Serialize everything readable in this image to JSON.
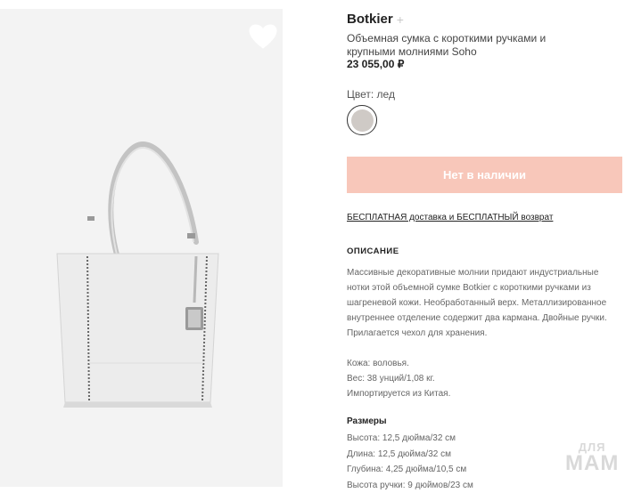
{
  "product": {
    "brand": "Botkier",
    "brand_plus": "+",
    "title": "Объемная сумка с короткими ручками и крупными молниями Soho",
    "price": "23 055,00 ₽"
  },
  "color": {
    "label": "Цвет: лед",
    "swatch_color": "#cfcac6"
  },
  "cta": {
    "label": "Нет в наличии",
    "color": "#f8c7ba"
  },
  "shipping": {
    "link": "БЕСПЛАТНАЯ доставка и БЕСПЛАТНЫЙ возврат"
  },
  "description": {
    "title": "ОПИСАНИЕ",
    "text": "Массивные декоративные молнии придают индустриальные нотки этой объемной сумке Botkier с короткими ручками из шагреневой кожи. Необработанный верх. Металлизированное внутреннее отделение содержит два кармана. Двойные ручки. Прилагается чехол для хранения.",
    "material": "Кожа: воловья.",
    "weight": "Вес: 38 унций/1,08 кг.",
    "origin": "Импортируется из Китая."
  },
  "sizes": {
    "title": "Размеры",
    "height": "Высота: 12,5 дюйма/32 см",
    "length": "Длина: 12,5 дюйма/32 см",
    "depth": "Глубина: 4,25 дюйма/10,5 см",
    "handle_height": "Высота ручки: 9 дюймов/23 см"
  },
  "watermark": {
    "top": "ДЛЯ",
    "bottom": "МАМ"
  },
  "icons": {
    "favorite": "heart-icon"
  }
}
